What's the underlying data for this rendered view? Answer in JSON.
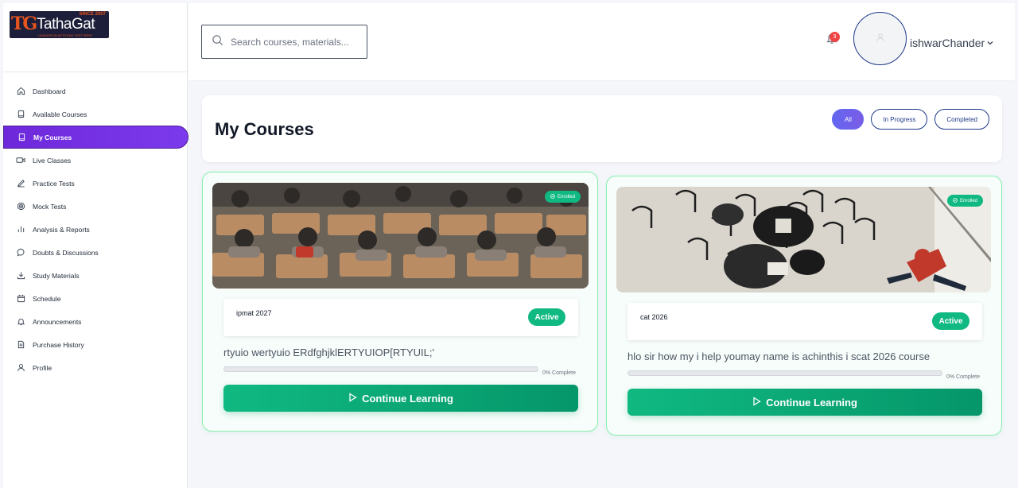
{
  "brand": {
    "logo_mark": "TG",
    "logo_name": "TathaGat",
    "logo_since": "SINCE 2007",
    "logo_tagline": "LEADERS IN APTITUDE TEST PREP"
  },
  "sidebar": {
    "items": [
      {
        "label": "Dashboard",
        "icon": "home-icon"
      },
      {
        "label": "Available Courses",
        "icon": "book-icon"
      },
      {
        "label": "My Courses",
        "icon": "book-icon",
        "active": true
      },
      {
        "label": "Live Classes",
        "icon": "video-icon"
      },
      {
        "label": "Practice Tests",
        "icon": "pencil-icon"
      },
      {
        "label": "Mock Tests",
        "icon": "target-icon"
      },
      {
        "label": "Analysis & Reports",
        "icon": "bar-chart-icon"
      },
      {
        "label": "Doubts & Discussions",
        "icon": "chat-icon"
      },
      {
        "label": "Study Materials",
        "icon": "download-icon"
      },
      {
        "label": "Schedule",
        "icon": "calendar-icon"
      },
      {
        "label": "Announcements",
        "icon": "bell-icon"
      },
      {
        "label": "Purchase History",
        "icon": "receipt-icon"
      },
      {
        "label": "Profile",
        "icon": "user-icon"
      }
    ]
  },
  "header": {
    "search_placeholder": "Search courses, materials...",
    "notification_count": "3",
    "username": "ishwarChander"
  },
  "main": {
    "title": "My Courses",
    "filters": [
      {
        "label": "All",
        "active": true
      },
      {
        "label": "In Progress",
        "active": false
      },
      {
        "label": "Completed",
        "active": false
      }
    ],
    "courses": [
      {
        "name": "ipmat 2027",
        "status": "Active",
        "enrolled_label": "Enrolled",
        "description": "rtyuio wertyuio ERdfghjklERTYUIOP[RTYUIL;'",
        "progress": 0,
        "progress_label": "0% Complete",
        "button_label": "Continue Learning",
        "image": "lecture-hall-photo"
      },
      {
        "name": "cat 2026",
        "status": "Active",
        "enrolled_label": "Enrolled",
        "description": "hlo sir how my i help youmay name is achinthis i scat 2026 course",
        "progress": 0,
        "progress_label": "0% Complete",
        "button_label": "Continue Learning",
        "image": "cafe-overhead-photo"
      }
    ]
  },
  "colors": {
    "accent_purple": "#7c3aed",
    "accent_green": "#10b981",
    "badge_red": "#ef4444"
  }
}
